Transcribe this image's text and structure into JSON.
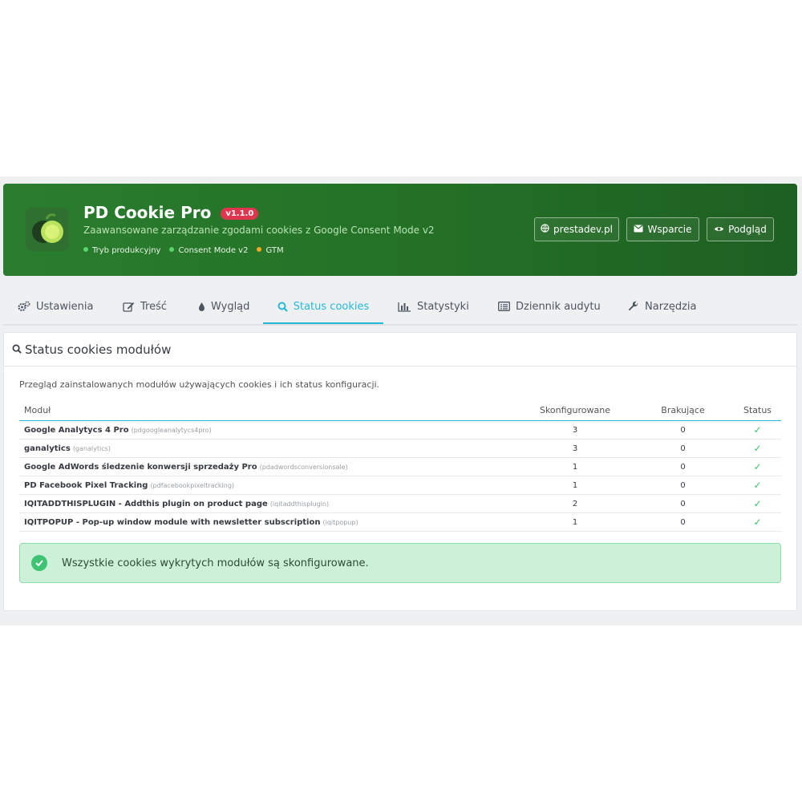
{
  "header": {
    "title": "PD Cookie Pro",
    "version": "v1.1.0",
    "subtitle": "Zaawansowane zarządzanie zgodami cookies z Google Consent Mode v2",
    "status_items": [
      {
        "label": "Tryb produkcyjny",
        "color": "#5ad46a"
      },
      {
        "label": "Consent Mode v2",
        "color": "#5ad46a"
      },
      {
        "label": "GTM",
        "color": "#f5a623"
      }
    ],
    "buttons": {
      "site": "prestadev.pl",
      "support": "Wsparcie",
      "preview": "Podgląd"
    }
  },
  "tabs": [
    {
      "label": "Ustawienia",
      "icon": "cogs-icon"
    },
    {
      "label": "Treść",
      "icon": "edit-icon"
    },
    {
      "label": "Wygląd",
      "icon": "tint-icon"
    },
    {
      "label": "Status cookies",
      "icon": "search-icon",
      "active": true
    },
    {
      "label": "Statystyki",
      "icon": "bar-chart-icon"
    },
    {
      "label": "Dziennik audytu",
      "icon": "list-alt-icon"
    },
    {
      "label": "Narzędzia",
      "icon": "wrench-icon"
    }
  ],
  "panel": {
    "title": "Status cookies modułów",
    "intro": "Przegląd zainstalowanych modułów używających cookies i ich status konfiguracji.",
    "columns": [
      "Moduł",
      "Skonfigurowane",
      "Brakujące",
      "Status"
    ],
    "rows": [
      {
        "name": "Google Analytycs 4 Pro",
        "tech": "(pdgoogleanalytycs4pro)",
        "configured": "3",
        "missing": "0",
        "status": "✓"
      },
      {
        "name": "ganalytics",
        "tech": "(ganalytics)",
        "configured": "3",
        "missing": "0",
        "status": "✓"
      },
      {
        "name": "Google AdWords śledzenie konwersji sprzedaży Pro",
        "tech": "(pdadwordsconversionsale)",
        "configured": "1",
        "missing": "0",
        "status": "✓"
      },
      {
        "name": "PD Facebook Pixel Tracking",
        "tech": "(pdfacebookpixeltracking)",
        "configured": "1",
        "missing": "0",
        "status": "✓"
      },
      {
        "name": "IQITADDTHISPLUGIN - Addthis plugin on product page",
        "tech": "(iqitaddthisplugin)",
        "configured": "2",
        "missing": "0",
        "status": "✓"
      },
      {
        "name": "IQITPOPUP - Pop-up window module with newsletter subscription",
        "tech": "(iqitpopup)",
        "configured": "1",
        "missing": "0",
        "status": "✓"
      }
    ],
    "alert": "Wszystkie cookies wykrytych modułów są skonfigurowane."
  },
  "colors": {
    "brand_green": "#2a7d2e",
    "accent": "#25b9d7",
    "success": "#3ec373"
  }
}
